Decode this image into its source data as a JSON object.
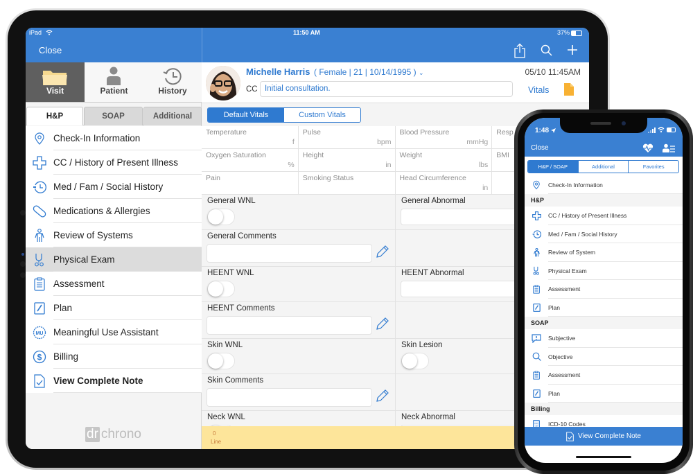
{
  "ipad": {
    "status_bar": {
      "device": "iPad",
      "time": "11:50 AM",
      "battery": "37%"
    },
    "nav": {
      "close_label": "Close"
    },
    "top_segments": [
      {
        "label": "Visit",
        "icon": "folder-icon",
        "active": true
      },
      {
        "label": "Patient",
        "icon": "person-icon",
        "active": false
      },
      {
        "label": "History",
        "icon": "history-clock-icon",
        "active": false
      }
    ],
    "sub_tabs": [
      {
        "label": "H&P",
        "active": true
      },
      {
        "label": "SOAP",
        "active": false
      },
      {
        "label": "Additional",
        "active": false
      }
    ],
    "menu": [
      {
        "label": "Check-In Information",
        "icon": "location-pin-icon"
      },
      {
        "label": "CC / History of Present Illness",
        "icon": "medical-cross-icon"
      },
      {
        "label": "Med / Fam / Social History",
        "icon": "history-clock-icon"
      },
      {
        "label": "Medications & Allergies",
        "icon": "pill-icon"
      },
      {
        "label": "Review of Systems",
        "icon": "body-icon"
      },
      {
        "label": "Physical Exam",
        "icon": "stethoscope-icon",
        "active": true
      },
      {
        "label": "Assessment",
        "icon": "clipboard-icon"
      },
      {
        "label": "Plan",
        "icon": "pen-note-icon"
      },
      {
        "label": "Meaningful Use Assistant",
        "icon": "mu-badge-icon"
      },
      {
        "label": "Billing",
        "icon": "dollar-icon"
      },
      {
        "label": "View Complete Note",
        "icon": "note-check-icon",
        "bold": true
      }
    ],
    "logo": {
      "dr": "dr",
      "chrono": "chrono"
    },
    "patient": {
      "name": "Michelle Harris",
      "info": "( Female | 21 | 10/14/1995 )",
      "visit_time": "05/10 11:45AM",
      "cc_label": "CC",
      "cc_value": "Initial consultation.",
      "vitals_link": "Vitals"
    },
    "vitals_tabs": [
      {
        "label": "Default Vitals",
        "active": true
      },
      {
        "label": "Custom Vitals",
        "active": false
      }
    ],
    "vitals": [
      [
        {
          "label": "Temperature",
          "unit": "f"
        },
        {
          "label": "Pulse",
          "unit": "bpm"
        },
        {
          "label": "Blood Pressure",
          "unit": "mmHg"
        },
        {
          "label": "Resp",
          "unit": ""
        }
      ],
      [
        {
          "label": "Oxygen Saturation",
          "unit": "%"
        },
        {
          "label": "Height",
          "unit": "in"
        },
        {
          "label": "Weight",
          "unit": "lbs"
        },
        {
          "label": "BMI",
          "unit": ""
        }
      ],
      [
        {
          "label": "Pain",
          "unit": ""
        },
        {
          "label": "Smoking Status",
          "unit": ""
        },
        {
          "label": "Head Circumference",
          "unit": "in"
        },
        {
          "label": "",
          "unit": ""
        }
      ]
    ],
    "exam": {
      "general_wnl": "General WNL",
      "general_abnormal": "General Abnormal",
      "general_comments": "General Comments",
      "heent_wnl": "HEENT WNL",
      "heent_abnormal": "HEENT Abnormal",
      "heent_comments": "HEENT Comments",
      "skin_wnl": "Skin WNL",
      "skin_lesion": "Skin Lesion",
      "skin_comments": "Skin Comments",
      "neck_wnl": "Neck WNL",
      "neck_abnormal": "Neck Abnormal"
    },
    "line_bar": {
      "count": "0",
      "label": "Line"
    }
  },
  "iphone": {
    "status_bar": {
      "time": "1:48"
    },
    "nav": {
      "close_label": "Close"
    },
    "tabs": [
      {
        "label": "H&P / SOAP",
        "active": true
      },
      {
        "label": "Additional",
        "active": false
      },
      {
        "label": "Favorites",
        "active": false
      }
    ],
    "checkin": {
      "label": "Check-In Information",
      "icon": "location-pin-icon"
    },
    "sections": [
      {
        "title": "H&P",
        "items": [
          {
            "label": "CC / History of Present Illness",
            "icon": "medical-cross-icon"
          },
          {
            "label": "Med / Fam / Social History",
            "icon": "history-clock-icon"
          },
          {
            "label": "Review of System",
            "icon": "body-icon"
          },
          {
            "label": "Physical Exam",
            "icon": "stethoscope-icon"
          },
          {
            "label": "Assessment",
            "icon": "clipboard-icon"
          },
          {
            "label": "Plan",
            "icon": "pen-note-icon"
          }
        ]
      },
      {
        "title": "SOAP",
        "items": [
          {
            "label": "Subjective",
            "icon": "speech-exclamation-icon"
          },
          {
            "label": "Objective",
            "icon": "search-icon"
          },
          {
            "label": "Assessment",
            "icon": "clipboard-icon"
          },
          {
            "label": "Plan",
            "icon": "pen-note-icon"
          }
        ]
      },
      {
        "title": "Billing",
        "items": [
          {
            "label": "ICD-10 Codes",
            "icon": "icd-book-icon"
          }
        ]
      }
    ],
    "view_note_label": "View Complete Note"
  },
  "colors": {
    "brand_blue": "#3a80d2",
    "link_blue": "#2f7ad0",
    "line_bar": "#fde59a",
    "note_orange": "#f8b133"
  }
}
